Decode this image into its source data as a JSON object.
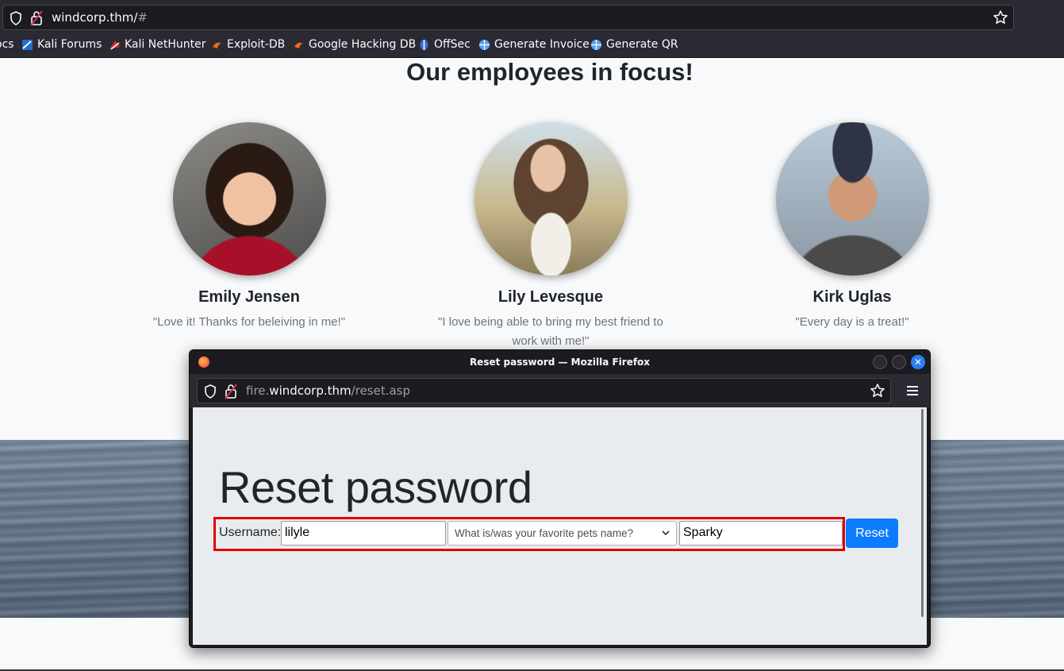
{
  "browser": {
    "url_host": "windcorp.thm/",
    "url_suffix": "#",
    "bookmarks": [
      {
        "label": "ocs",
        "icon": "cut-off-icon"
      },
      {
        "label": "Kali Forums",
        "icon": "kali-forums-icon"
      },
      {
        "label": "Kali NetHunter",
        "icon": "kali-nethunter-icon"
      },
      {
        "label": "Exploit-DB",
        "icon": "exploit-db-icon"
      },
      {
        "label": "Google Hacking DB",
        "icon": "ghdb-icon"
      },
      {
        "label": "OffSec",
        "icon": "offsec-icon"
      },
      {
        "label": "Generate Invoice",
        "icon": "globe-icon"
      },
      {
        "label": "Generate QR",
        "icon": "globe-icon"
      }
    ]
  },
  "page": {
    "heading": "Our employees in focus!",
    "employees": [
      {
        "name": "Emily Jensen",
        "quote": "\"Love it! Thanks for beleiving in me!\""
      },
      {
        "name": "Lily Levesque",
        "quote": "\"I love being able to bring my best friend to work with me!\""
      },
      {
        "name": "Kirk Uglas",
        "quote": "\"Every day is a treat!\""
      }
    ]
  },
  "popup": {
    "window_title": "Reset password — Mozilla Firefox",
    "url_prefix": "fire.",
    "url_host": "windcorp.thm",
    "url_path": "/reset.asp",
    "form": {
      "title": "Reset password",
      "username_label": "Username:",
      "username_value": "lilyle",
      "question_selected": "What is/was your favorite pets name?",
      "answer_value": "Sparky",
      "reset_label": "Reset"
    }
  }
}
